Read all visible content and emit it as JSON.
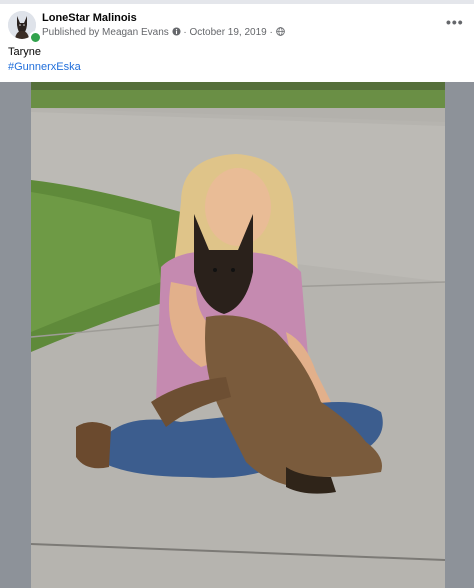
{
  "post": {
    "page_name": "LoneStar Malinois",
    "published_prefix": "Published by",
    "publisher": "Meagan Evans",
    "date": "October 19, 2019",
    "caption": "Taryne",
    "hashtag": "#GunnerxEska",
    "icons": {
      "avatar": "malinois-dog-avatar",
      "info": "info-icon",
      "audience": "globe-icon",
      "menu": "more-options-icon"
    },
    "colors": {
      "link": "#216fdb",
      "online": "#31a24c",
      "meta_text": "#65676b"
    }
  }
}
